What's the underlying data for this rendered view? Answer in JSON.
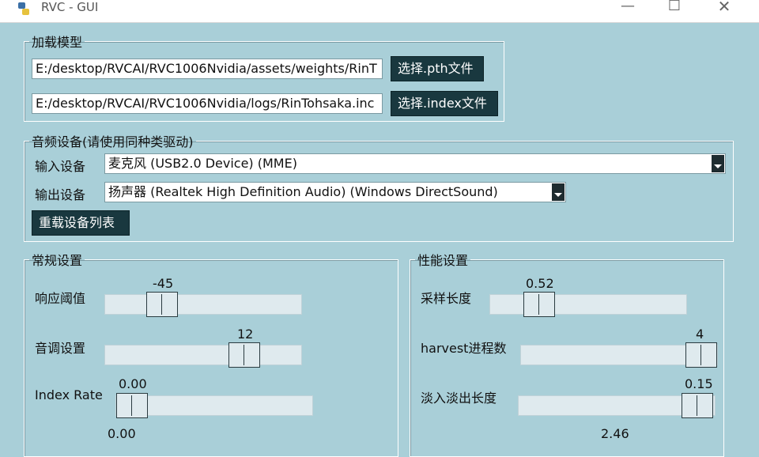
{
  "window": {
    "title": "RVC - GUI"
  },
  "load_model": {
    "group_title": "加载模型",
    "pth_path": "E:/desktop/RVCAI/RVC1006Nvidia/assets/weights/RinT",
    "pth_button": "选择.pth文件",
    "index_path": "E:/desktop/RVCAI/RVC1006Nvidia/logs/RinTohsaka.inc",
    "index_button": "选择.index文件"
  },
  "audio_device": {
    "group_title": "音频设备(请使用同种类驱动)",
    "input_label": "输入设备",
    "input_value": "麦克风 (USB2.0 Device) (MME)",
    "output_label": "输出设备",
    "output_value": "扬声器 (Realtek High Definition Audio) (Windows DirectSound)",
    "reload_button": "重载设备列表"
  },
  "general": {
    "group_title": "常规设置",
    "sliders": [
      {
        "label": "响应阈值",
        "value": "-45"
      },
      {
        "label": "音调设置",
        "value": "12"
      },
      {
        "label": "Index Rate",
        "value": "0.00"
      },
      {
        "label": "",
        "value": "0.00"
      }
    ]
  },
  "performance": {
    "group_title": "性能设置",
    "sliders": [
      {
        "label": "采样长度",
        "value": "0.52"
      },
      {
        "label": "harvest进程数",
        "value": "4"
      },
      {
        "label": "淡入淡出长度",
        "value": "0.15"
      },
      {
        "label": "",
        "value": "2.46"
      }
    ]
  }
}
